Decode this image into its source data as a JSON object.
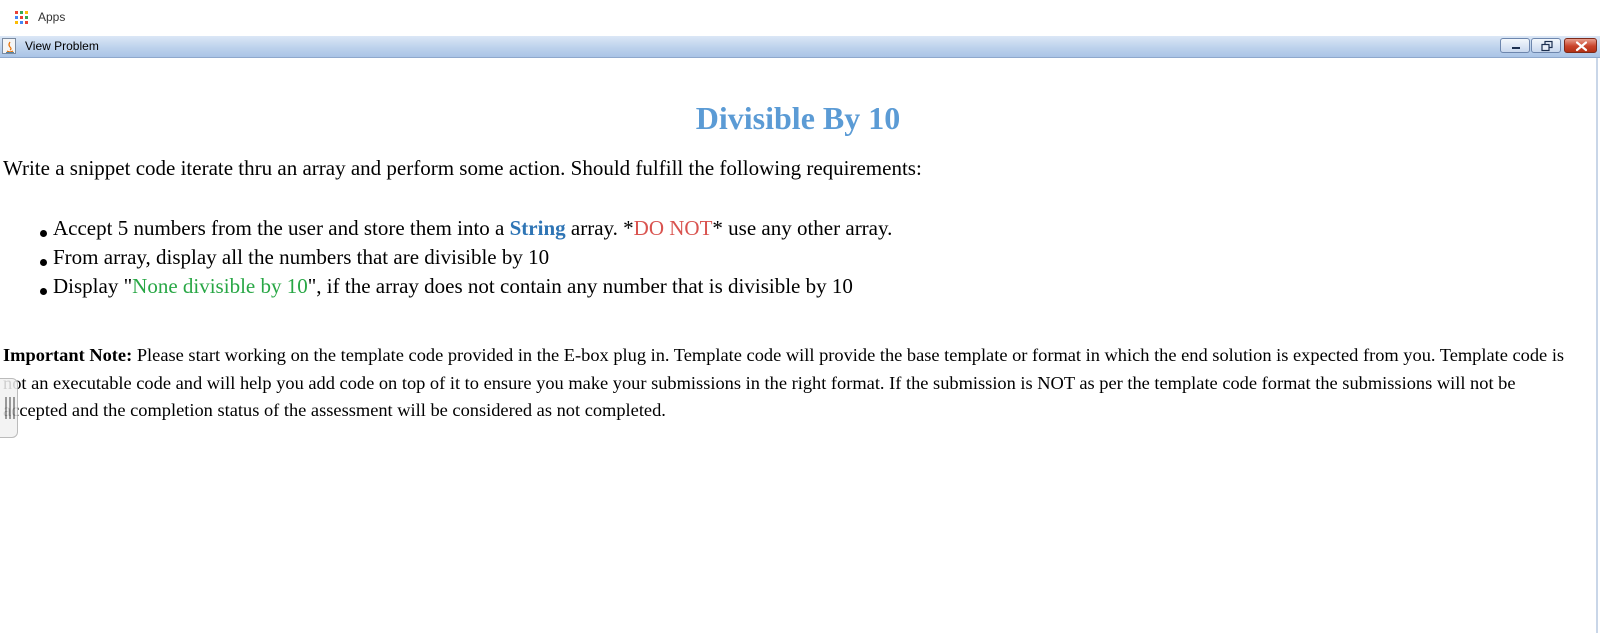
{
  "bookmarks": {
    "apps_label": "Apps"
  },
  "window": {
    "title": "View Problem"
  },
  "problem": {
    "title": "Divisible By 10",
    "intro": "Write a snippet code iterate thru an array and perform some action. Should fulfill the following requirements:",
    "requirements": [
      {
        "p1": "Accept 5 numbers from the user and store them into a ",
        "k1": "String",
        "p2": " array. *",
        "k2": "DO NOT",
        "p3": "* use any other array."
      },
      {
        "p1": "From array, display all the numbers that are divisible by 10"
      },
      {
        "p1": "Display \"",
        "k1": "None divisible by 10",
        "p2": "\", if the array does not contain any number that is divisible by 10"
      }
    ],
    "note_label": "Important Note:",
    "note_text": " Please start working on the template code provided in the E-box plug in. Template code will provide the base template or format in which the end solution is expected from you. Template code is not an executable code and will help you add code on top of it to ensure you make your submissions in the right format. If the submission is NOT as per the template code format the submissions will not be accepted and the completion status of the assessment will be considered as not completed."
  },
  "colors": {
    "title": "#5b9bd5",
    "keyword_blue": "#2f75b5",
    "keyword_red": "#d9534f",
    "keyword_green": "#28a745"
  },
  "icons": {
    "apps": "apps-grid-icon",
    "window": "java-app-icon",
    "minimize": "minimize-icon",
    "maximize": "restore-icon",
    "close": "close-icon"
  }
}
